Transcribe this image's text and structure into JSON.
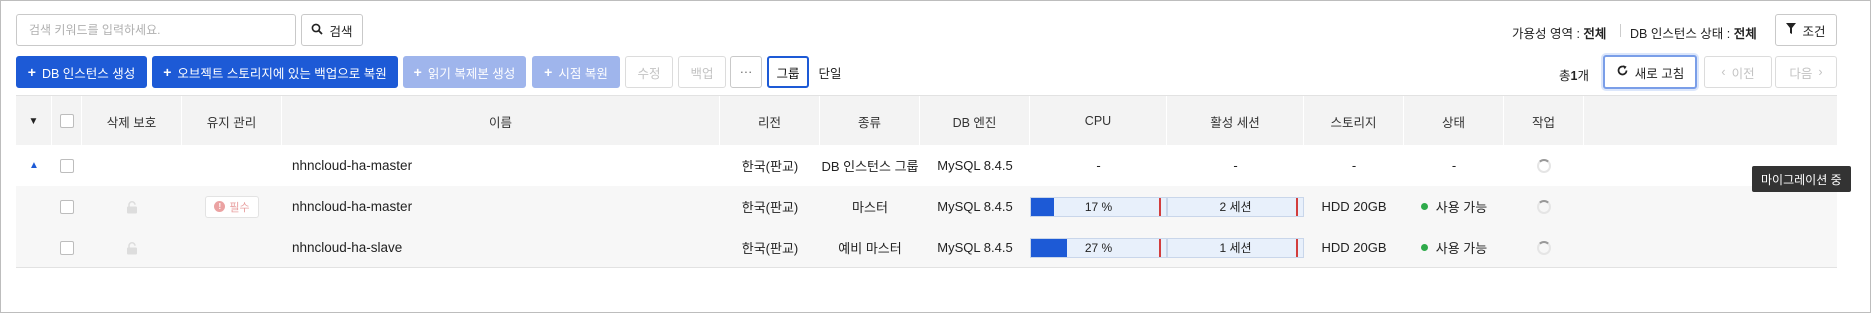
{
  "search": {
    "placeholder": "검색 키워드를 입력하세요.",
    "button_label": "검색"
  },
  "filters": {
    "availability_label": "가용성 영역 :",
    "availability_value": "전체",
    "state_label": "DB 인스턴스 상태 :",
    "state_value": "전체",
    "condition_button": "조건"
  },
  "toolbar": {
    "create_instance": "DB 인스턴스 생성",
    "restore_from_object_storage": "오브젝트 스토리지에 있는 백업으로 복원",
    "create_read_replica": "읽기 복제본 생성",
    "point_in_time_restore": "시점 복원",
    "modify": "수정",
    "backup": "백업",
    "more": "···",
    "view_group": "그룹",
    "view_single": "단일",
    "total_prefix": "총",
    "total_count": "1",
    "total_suffix": "개",
    "refresh": "새로 고침",
    "prev": "이전",
    "next": "다음"
  },
  "columns": [
    "삭제 보호",
    "유지 관리",
    "이름",
    "리전",
    "종류",
    "DB 엔진",
    "CPU",
    "활성 세션",
    "스토리지",
    "상태",
    "작업"
  ],
  "rows": [
    {
      "name": "nhncloud-ha-master",
      "region": "한국(판교)",
      "type": "DB 인스턴스 그룹",
      "engine": "MySQL 8.4.5",
      "cpu": "-",
      "sessions": "-",
      "storage": "-",
      "status": "-"
    },
    {
      "name": "nhncloud-ha-master",
      "maintenance": "필수",
      "region": "한국(판교)",
      "type": "마스터",
      "engine": "MySQL 8.4.5",
      "cpu_text": "17 %",
      "cpu_value": 17,
      "sessions_text": "2 세션",
      "sessions_value": 0,
      "storage": "HDD 20GB",
      "status": "사용 가능"
    },
    {
      "name": "nhncloud-ha-slave",
      "region": "한국(판교)",
      "type": "예비 마스터",
      "engine": "MySQL 8.4.5",
      "cpu_text": "27 %",
      "cpu_value": 27,
      "sessions_text": "1 세션",
      "sessions_value": 0,
      "storage": "HDD 20GB",
      "status": "사용 가능"
    }
  ],
  "tooltip": "마이그레이션 중",
  "colors": {
    "primary": "#1d5ad6",
    "primary_disabled": "#9fb5ec",
    "status_ok": "#2eaa4a",
    "threshold": "#d23d3d"
  }
}
